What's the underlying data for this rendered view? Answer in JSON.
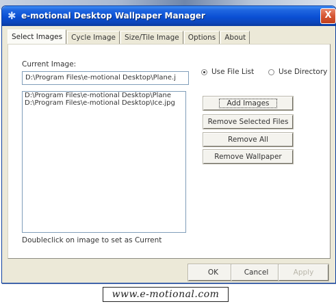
{
  "window": {
    "title": "e-motional Desktop Wallpaper Manager",
    "close_label": "X"
  },
  "tabs": [
    {
      "label": "Select Images"
    },
    {
      "label": "Cycle Image"
    },
    {
      "label": "Size/Tile Image"
    },
    {
      "label": "Options"
    },
    {
      "label": "About"
    }
  ],
  "select_images": {
    "current_image_label": "Current Image:",
    "current_image_value": "D:\\Program Files\\e-motional Desktop\\Plane.j",
    "files": [
      "D:\\Program Files\\e-motional Desktop\\Plane",
      "D:\\Program Files\\e-motional Desktop\\Ice.jpg"
    ],
    "source_options": [
      {
        "label": "Use File List",
        "selected": true
      },
      {
        "label": "Use Directory",
        "selected": false
      }
    ],
    "buttons": {
      "add": "Add Images",
      "remove_selected": "Remove Selected Files",
      "remove_all": "Remove All",
      "remove_wallpaper": "Remove Wallpaper"
    },
    "hint": "Doubleclick on image to set as Current"
  },
  "dialog_buttons": {
    "ok": "OK",
    "cancel": "Cancel",
    "apply": "Apply"
  },
  "banner": "www.e-motional.com",
  "icons": {
    "app": "app-icon"
  }
}
